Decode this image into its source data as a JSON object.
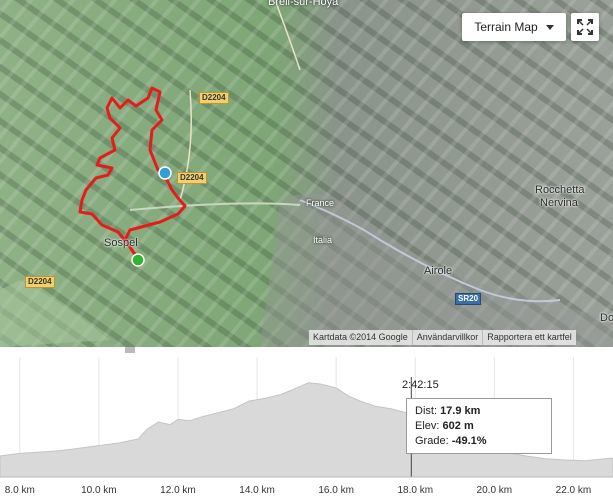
{
  "map": {
    "places": [
      {
        "name": "Breil-sur-Hoya"
      },
      {
        "name": "Rocchetta"
      },
      {
        "name": "Nervina"
      },
      {
        "name": "France"
      },
      {
        "name": "Italia"
      },
      {
        "name": "Airole"
      },
      {
        "name": "Sospel"
      },
      {
        "name": "Do"
      }
    ],
    "roads": [
      "D2204",
      "D2204",
      "D2204",
      "SR20"
    ],
    "map_type_button": "Terrain Map",
    "fullscreen_icon": "fullscreen-icon",
    "attribution": [
      "Kartdata ©2014 Google",
      "Användarvillkor",
      "Rapportera ett kartfel"
    ],
    "markers": {
      "start_color": "#2fb62f",
      "end_color": "#2e9fd9"
    },
    "route_color": "#e51c1c"
  },
  "profile": {
    "x_ticks": [
      "8.0 km",
      "10.0 km",
      "12.0 km",
      "14.0 km",
      "16.0 km",
      "18.0 km",
      "20.0 km",
      "22.0 km"
    ],
    "cursor_time": "2:42:15",
    "tooltip": {
      "dist_label": "Dist:",
      "dist_value": "17.9 km",
      "elev_label": "Elev:",
      "elev_value": "602 m",
      "grade_label": "Grade:",
      "grade_value": "-49.1%"
    },
    "x_range": [
      7.5,
      23
    ],
    "cursor_km": 17.9,
    "elevation": [
      [
        7.5,
        380
      ],
      [
        8.0,
        390
      ],
      [
        8.5,
        395
      ],
      [
        9.0,
        400
      ],
      [
        9.5,
        410
      ],
      [
        10.0,
        420
      ],
      [
        10.5,
        430
      ],
      [
        11.0,
        445
      ],
      [
        11.2,
        480
      ],
      [
        11.5,
        510
      ],
      [
        11.8,
        500
      ],
      [
        12.0,
        520
      ],
      [
        12.3,
        515
      ],
      [
        12.6,
        530
      ],
      [
        13.0,
        545
      ],
      [
        13.4,
        560
      ],
      [
        13.8,
        590
      ],
      [
        14.2,
        600
      ],
      [
        14.6,
        615
      ],
      [
        15.0,
        640
      ],
      [
        15.3,
        660
      ],
      [
        15.6,
        655
      ],
      [
        16.0,
        640
      ],
      [
        16.3,
        610
      ],
      [
        16.6,
        590
      ],
      [
        17.0,
        570
      ],
      [
        17.4,
        560
      ],
      [
        17.9,
        540
      ],
      [
        18.3,
        510
      ],
      [
        18.8,
        480
      ],
      [
        19.3,
        450
      ],
      [
        19.8,
        420
      ],
      [
        20.3,
        395
      ],
      [
        20.8,
        380
      ],
      [
        21.3,
        370
      ],
      [
        21.8,
        365
      ],
      [
        22.3,
        362
      ],
      [
        22.8,
        370
      ],
      [
        23.0,
        372
      ]
    ],
    "y_range": [
      300,
      720
    ]
  }
}
